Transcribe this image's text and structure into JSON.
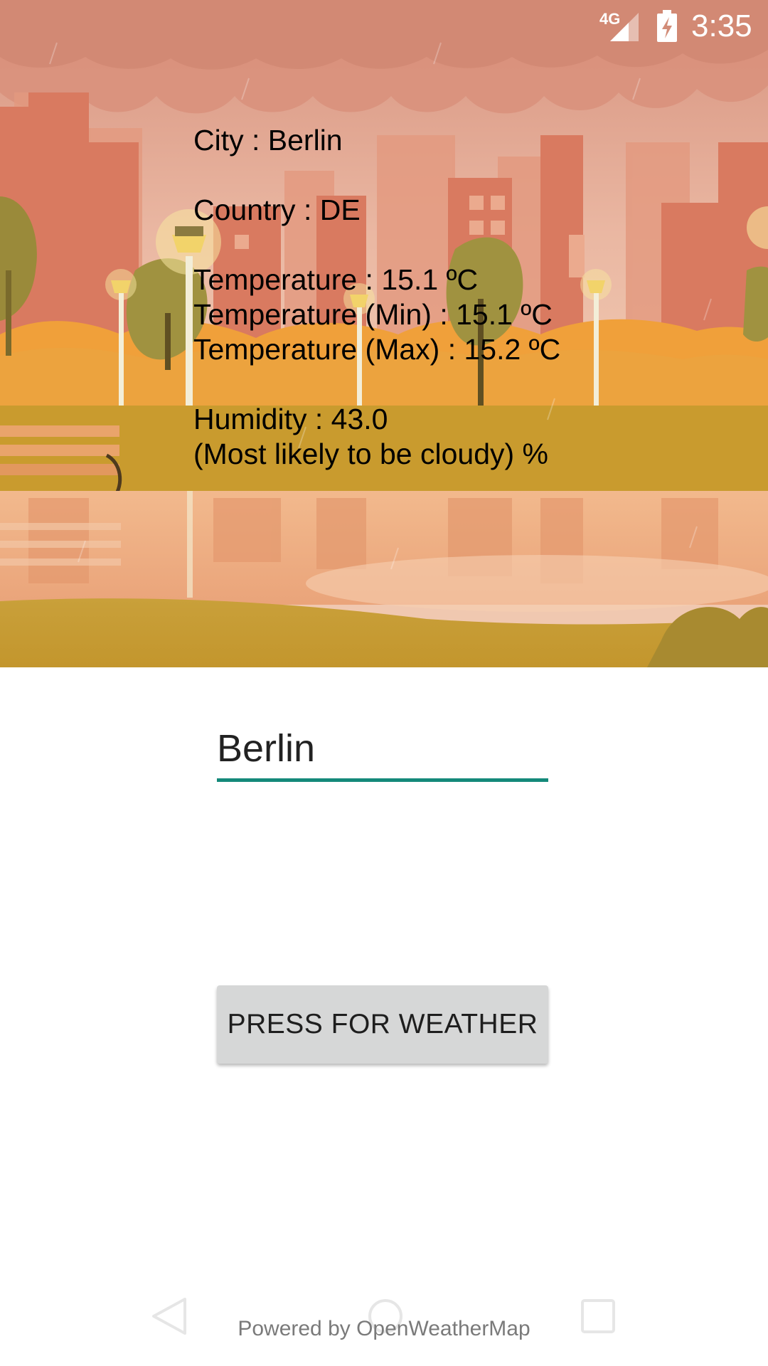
{
  "status_bar": {
    "network": "4G",
    "time": "3:35"
  },
  "weather": {
    "city_line": "City : Berlin",
    "country_line": "Country : DE",
    "temp_line": "Temperature : 15.1 ºC",
    "temp_min_line": "Temperature (Min) : 15.1 ºC",
    "temp_max_line": "Temperature (Max) : 15.2 ºC",
    "humidity_line": "Humidity : 43.0",
    "description_line": "(Most likely to be cloudy) %"
  },
  "city_input": {
    "value": "Berlin"
  },
  "weather_button": {
    "label": "PRESS FOR WEATHER"
  },
  "footer": {
    "credit": "Powered by OpenWeatherMap"
  },
  "colors": {
    "accent_underline": "#14897a",
    "button_bg": "#d6d7d7"
  },
  "icons": {
    "signal": "cell-signal-icon",
    "battery": "battery-charging-icon",
    "back": "nav-back-icon",
    "home": "nav-home-icon",
    "recents": "nav-recents-icon"
  }
}
